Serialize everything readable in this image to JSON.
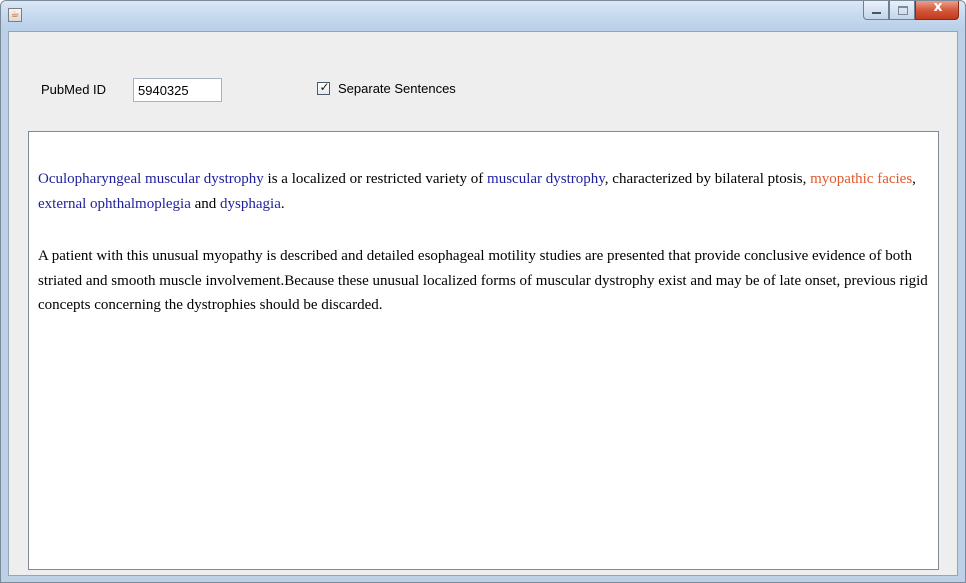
{
  "window": {
    "title": "",
    "app_icon": "java-cup-icon",
    "caption_buttons": [
      "minimize-icon",
      "maximize-icon",
      "close-icon"
    ]
  },
  "form": {
    "pubmed_label": "PubMed ID",
    "pubmed_value": "5940325",
    "separate_sentences_label": "Separate Sentences",
    "separate_sentences_checked": true
  },
  "colors": {
    "disease_entity": "#1f1f9e",
    "sign_entity": "#e0592e",
    "titlebar": "#c7daef",
    "panel": "#eeeeee"
  },
  "abstract": {
    "paragraphs": [
      {
        "segments": [
          {
            "text": "Oculopharyngeal muscular dystrophy",
            "type": "disease"
          },
          {
            "text": " is a localized or restricted variety of ",
            "type": "plain"
          },
          {
            "text": "muscular dystrophy",
            "type": "disease"
          },
          {
            "text": ", characterized by bilateral ptosis, ",
            "type": "plain"
          },
          {
            "text": "myopathic facies",
            "type": "sign"
          },
          {
            "text": ", ",
            "type": "plain"
          },
          {
            "text": "external ophthalmoplegia",
            "type": "disease"
          },
          {
            "text": " and ",
            "type": "plain"
          },
          {
            "text": "dysphagia",
            "type": "disease"
          },
          {
            "text": ".",
            "type": "plain"
          }
        ]
      },
      {
        "segments": [
          {
            "text": "A patient with this unusual myopathy is described  and detailed esophageal motility studies are presented that provide conclusive evidence of both striated and smooth muscle involvement.Because these unusual localized forms of muscular dystrophy exist and may be of late onset, previous rigid concepts concerning the dystrophies should be discarded.",
            "type": "plain"
          }
        ]
      }
    ]
  }
}
